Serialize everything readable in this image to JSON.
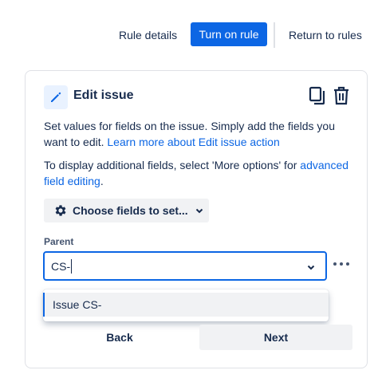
{
  "toolbar": {
    "rule_details_label": "Rule details",
    "turn_on_rule_label": "Turn on rule",
    "return_to_rules_label": "Return to rules"
  },
  "card": {
    "title": "Edit issue",
    "header_icons": [
      "pencil-icon",
      "copy-icon",
      "trash-icon"
    ],
    "description_text": "Set values for fields on the issue. Simply add the fields you want to edit. ",
    "description_link": "Learn more about Edit issue action",
    "options_text": "To display additional fields, select 'More options' for ",
    "options_link": "advanced field editing",
    "options_suffix": ".",
    "choose_fields_label": "Choose fields to set...",
    "parent_field": {
      "label": "Parent",
      "value": "CS-",
      "options": [
        "Issue CS-"
      ]
    },
    "back_label": "Back",
    "next_label": "Next"
  },
  "colors": {
    "primary": "#0c66e4",
    "text": "#172b4d",
    "subtle_bg": "#f1f2f4",
    "icon_bg": "#e9f2ff"
  }
}
